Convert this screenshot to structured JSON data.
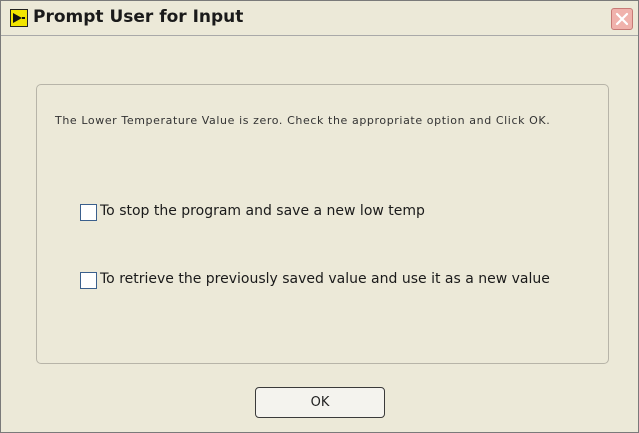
{
  "window": {
    "title": "Prompt User for Input"
  },
  "dialog": {
    "message": "The  Lower Temperature Value is zero. Check the appropriate option and Click OK.",
    "options": [
      {
        "label": "To stop the program and save a new low temp",
        "checked": false
      },
      {
        "label": "To retrieve the previously saved value and use it as a new value",
        "checked": false
      }
    ],
    "ok_label": "OK"
  },
  "icons": {
    "app": "labview-vi-icon",
    "close": "close-icon"
  },
  "colors": {
    "window_background": "#ece9d8",
    "close_button": "#f0b2ac",
    "app_icon": "#f2e500"
  }
}
